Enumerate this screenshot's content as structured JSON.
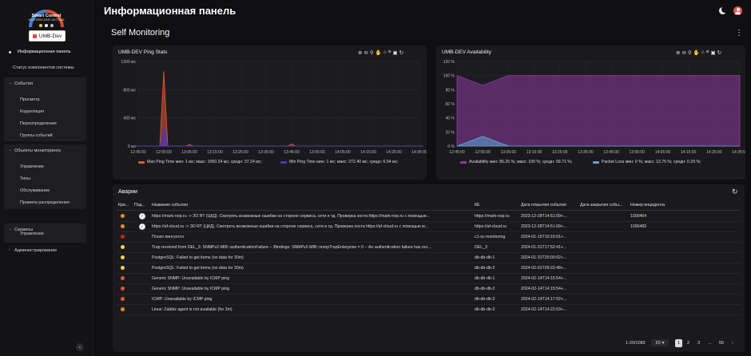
{
  "brand": {
    "title": "Smart Control",
    "subtitle": "КОМПЛЕКСНАЯ СИСТЕМА",
    "dot_colors": [
      "#f3c64b",
      "#ffffff",
      "#c0c0c0"
    ]
  },
  "environment": "UMB-Dev",
  "header": {
    "title": "Информационная панель",
    "moon_icon": "moon-icon",
    "user_icon": "user-icon"
  },
  "page": {
    "title": "Self Monitoring"
  },
  "sidebar": {
    "items": [
      {
        "label": "Информационная панель"
      },
      {
        "label": "Статус компонентов системы"
      }
    ],
    "groups": [
      {
        "title": "События",
        "items": [
          "Просмотр",
          "Корреляция",
          "Переопределения",
          "Группы событий"
        ]
      },
      {
        "title": "Объекты мониторинга",
        "items": [
          "Управление",
          "Типы",
          "Обслуживание",
          "Правила распределения"
        ]
      },
      {
        "title": "Сервисы",
        "items": [
          "Управление"
        ]
      }
    ],
    "admin": "Администрирование"
  },
  "charts": [
    {
      "title": "UMB-DEV Ping Stats",
      "legend": [
        {
          "text": "Max Ping Time мин: 1 мс; макс: 1060.24 мс; средн: 37.24 мс;",
          "color": "#e8562e"
        },
        {
          "text": "Min Ping Time мин: 1 мс; макс: 272.40 мс; средн: 6.94 мс;",
          "color": "#3a3ad6"
        }
      ]
    },
    {
      "title": "UMB-DEV Availability",
      "legend": [
        {
          "text": "Availability мин: 86.25 %; макс: 100 %; средн: 99.71 %;",
          "color": "#8e3a9e"
        },
        {
          "text": "Packet Loss мин: 0 %; макс: 13.75 %; средн: 0.29 %;",
          "color": "#5aa9d6"
        }
      ]
    }
  ],
  "chart_data": [
    {
      "type": "area",
      "title": "UMB-DEV Ping Stats",
      "x": [
        "12:45:00",
        "12:55:00",
        "13:05:00",
        "13:15:00",
        "13:25:00",
        "13:35:00",
        "13:45:00",
        "13:55:00",
        "14:05:00",
        "14:15:00",
        "14:25:00",
        "14:35:00"
      ],
      "y_ticks": [
        "0 мс",
        "400 мс",
        "800 мс",
        "1200 мс"
      ],
      "ylim": [
        0,
        1200
      ],
      "series": [
        {
          "name": "Max Ping Time",
          "color": "#e8562e",
          "values": [
            0,
            1060,
            20,
            0,
            0,
            0,
            30,
            0,
            0,
            0,
            0,
            0
          ]
        },
        {
          "name": "Min Ping Time",
          "color": "#3a3ad6",
          "values": [
            0,
            272,
            5,
            0,
            0,
            0,
            5,
            0,
            0,
            0,
            0,
            0
          ]
        }
      ]
    },
    {
      "type": "area",
      "title": "UMB-DEV Availability",
      "x": [
        "12:45:00",
        "12:55:00",
        "13:05:00",
        "13:15:00",
        "13:25:00",
        "13:35:00",
        "13:45:00",
        "13:55:00",
        "14:05:00",
        "14:15:00",
        "14:25:00",
        "14:35:00"
      ],
      "y_ticks": [
        "0 %",
        "20 %",
        "40 %",
        "60 %",
        "80 %",
        "100 %",
        "120 %"
      ],
      "ylim": [
        0,
        120
      ],
      "series": [
        {
          "name": "Availability",
          "color": "#8e3a9e",
          "values": [
            100,
            86.25,
            100,
            100,
            100,
            100,
            100,
            100,
            100,
            100,
            100,
            100
          ]
        },
        {
          "name": "Packet Loss",
          "color": "#5aa9d6",
          "values": [
            0,
            13.75,
            0,
            0,
            0,
            0,
            0,
            0,
            0,
            0,
            0,
            0
          ]
        }
      ]
    }
  ],
  "alarms": {
    "title": "Аварии",
    "columns": [
      "Кри...",
      "Под...",
      "Название события",
      "КЕ",
      "Дата открытия события",
      "Дата закрытия собы...",
      "Номер инцидента"
    ],
    "rows": [
      {
        "sev": "#f28a1f",
        "ack": true,
        "name": "https://mark-nop.ru -> ЗО RT (ЦКД). Смотреть возможные ошибки на стороне сервиса, сети и тд. Проверка хоста https://mark-nop.ru с помощью...",
        "ke": "https://mark-nop.ru",
        "opened": "2023-12-28T14:51:09+...",
        "closed": "",
        "incident": "1000464"
      },
      {
        "sev": "#f28a1f",
        "ack": true,
        "name": "https://af-cloud.ru -> ЗО RT (ЦКД). Смотреть возможные ошибки на стороне сервиса, сети и тд. Проверка хоста https://af-cloud.ru с помощью м...",
        "ke": "https://af-cloud.ru",
        "opened": "2023-12-28T14:51:09+...",
        "closed": "",
        "incident": "1000465"
      },
      {
        "sev": "#c81f1f",
        "ack": false,
        "name": "Плохо пингуется",
        "ke": "c1-sc-monitoring",
        "opened": "2024-01-15T10:15:01+...",
        "closed": "",
        "incident": ""
      },
      {
        "sev": "#f5d33b",
        "ack": false,
        "name": "Trap received from DEL_3: SNMPv2-MIB::authenticationFailure -- Bindings: SNMPv2-MIB::snmpTrapEnterprise = 0 -- An authentication failure has occ...",
        "ke": "DEL_3",
        "opened": "2024-01-31T17:52:41+...",
        "closed": "",
        "incident": ""
      },
      {
        "sev": "#f5d33b",
        "ack": false,
        "name": "PostgreSQL: Failed to get items (no data for 30m)",
        "ke": "db-db-db-1",
        "opened": "2024-01-31T20:00:02+...",
        "closed": "",
        "incident": ""
      },
      {
        "sev": "#f5d33b",
        "ack": false,
        "name": "PostgreSQL: Failed to get items (no data for 30m)",
        "ke": "db-db-db-2",
        "opened": "2024-02-01T09:22:48+...",
        "closed": "",
        "incident": ""
      },
      {
        "sev": "#e8562e",
        "ack": false,
        "name": "Generic SNMP: Unavailable by ICMP ping",
        "ke": "db-db-db-1",
        "opened": "2024-02-14T14:15:54+...",
        "closed": "",
        "incident": ""
      },
      {
        "sev": "#e8562e",
        "ack": false,
        "name": "Generic SNMP: Unavailable by ICMP ping",
        "ke": "db-db-db-2",
        "opened": "2024-02-14T14:15:54+...",
        "closed": "",
        "incident": ""
      },
      {
        "sev": "#e8562e",
        "ack": false,
        "name": "ICMP: Unavailable by ICMP ping",
        "ke": "db-db-db-3",
        "opened": "2024-02-14T14:17:02+...",
        "closed": "",
        "incident": ""
      },
      {
        "sev": "#f28a1f",
        "ack": false,
        "name": "Linux: Zabbix agent is not available (for 3m)",
        "ke": "db-db-db-3",
        "opened": "2024-02-14T14:22:03+...",
        "closed": "",
        "incident": ""
      }
    ],
    "pager": {
      "range": "1-20/1082",
      "page_size": "20",
      "pages": [
        "1",
        "2",
        "3",
        "...",
        "55"
      ]
    }
  }
}
